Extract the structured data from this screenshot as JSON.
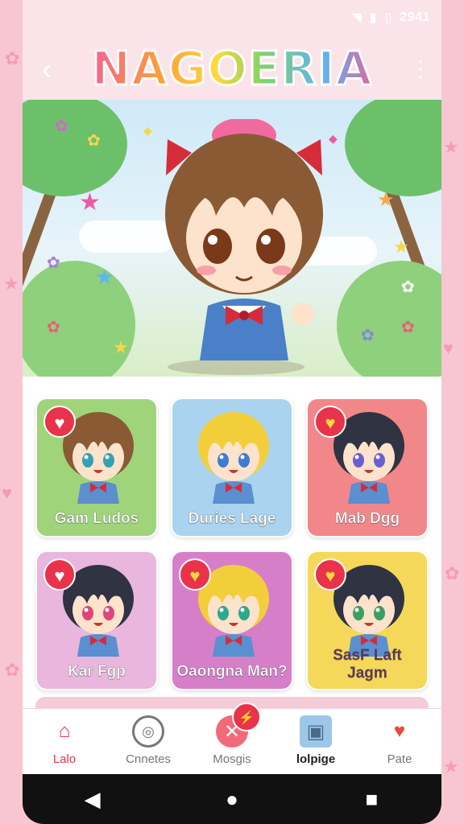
{
  "status_bar": {
    "time": "2941",
    "icons": [
      "wifi-icon",
      "signal-icon",
      "battery-icon"
    ]
  },
  "header": {
    "title": "NAGOERIA",
    "back_icon": "chevron-left-icon",
    "more_icon": "more-vertical-icon"
  },
  "cards": [
    {
      "name": "Gam Ludos",
      "favorite": "heart",
      "bg": "#9fd47a",
      "hair": "#8a5a34",
      "eyes": "#36a0b4"
    },
    {
      "name": "Duries Lage",
      "favorite": "none",
      "bg": "#a9d3ee",
      "hair": "#f2cf3a",
      "eyes": "#3f7bd2"
    },
    {
      "name": "Mab Dgg",
      "favorite": "heart-yellow",
      "bg": "#f2878a",
      "hair": "#2f3342",
      "eyes": "#6a5fd0"
    },
    {
      "name": "Kar Fgp",
      "favorite": "heart",
      "bg": "#e9b6dd",
      "hair": "#2f3342",
      "eyes": "#e0457a"
    },
    {
      "name": "Oaongna Man?",
      "favorite": "heart-yellow",
      "bg": "#d77ec9",
      "hair": "#f2cf3a",
      "eyes": "#2fa88a"
    },
    {
      "name": "SasF Laft Jagm",
      "favorite": "heart-yellow",
      "bg": "#f5d85a",
      "hair": "#2f3342",
      "eyes": "#3aa060"
    }
  ],
  "tabs": [
    {
      "label": "Lalo",
      "icon": "home-icon"
    },
    {
      "label": "Cnnetes",
      "icon": "radar-icon"
    },
    {
      "label": "Mosgis",
      "icon": "compass-icon"
    },
    {
      "label": "lolpige",
      "icon": "media-icon"
    },
    {
      "label": "Pate",
      "icon": "heart-lollipop-icon"
    }
  ],
  "notification": {
    "text": "⚡"
  },
  "nav": {
    "back_icon": "triangle-back-icon",
    "home_icon": "circle-home-icon",
    "recents_icon": "square-recents-icon"
  },
  "colors": {
    "accent": "#e8334a",
    "page_bg": "#f8c6d3",
    "panel_bg": "#fbe3ea"
  }
}
